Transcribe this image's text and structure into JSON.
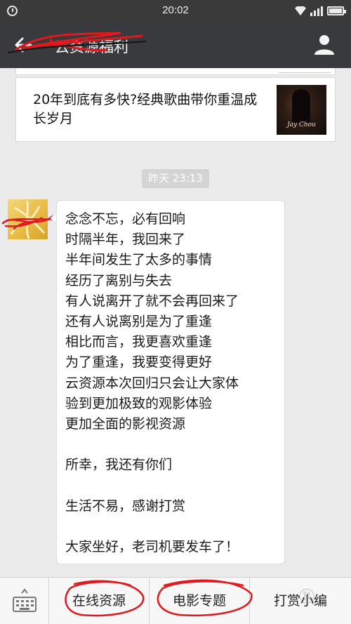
{
  "status_bar": {
    "time": "20:02",
    "left_icon": "alarm-icon",
    "right_icons": [
      "wifi-icon",
      "signal-icon",
      "battery-icon"
    ]
  },
  "nav": {
    "back_icon": "back-arrow-icon",
    "title": "云资源福利",
    "profile_icon": "user-icon",
    "background": "#393a3e"
  },
  "article": {
    "title": "20年到底有多快?经典歌曲带你重温成长岁月",
    "thumbnail_caption": "Jay Chou"
  },
  "chat": {
    "timestamp": "昨天 23:13",
    "message": "念念不忘，必有回响\n时隔半年，我回来了\n半年间发生了太多的事情\n经历了离别与失去\n有人说离开了就不会再回来了\n还有人说离别是为了重逢\n相比而言，我更喜欢重逢\n为了重逢，我要变得更好\n云资源本次回归只会让大家体\n验到更加极致的观影体验\n更加全面的影视资源\n\n所幸，我还有你们\n\n生活不易，感谢打赏\n\n大家坐好，老司机要发车了！"
  },
  "bottom_menu": {
    "keyboard_icon": "keyboard-icon",
    "items": [
      {
        "label": "在线资源"
      },
      {
        "label": "电影专题"
      },
      {
        "label": "打赏小编"
      }
    ]
  },
  "colors": {
    "background": "#ebebeb",
    "annotation_ink": "#e0191e",
    "timestamp_badge": "#d4d4d4"
  }
}
